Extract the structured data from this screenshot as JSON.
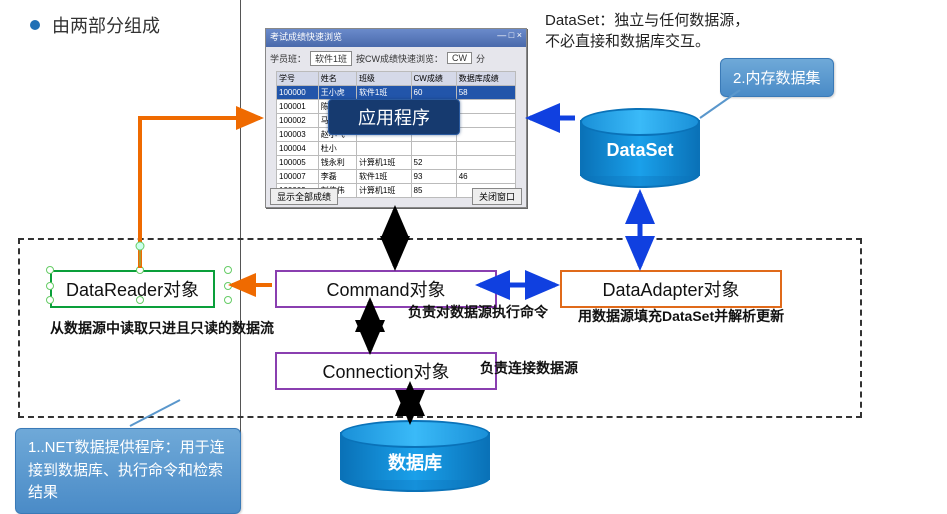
{
  "header": {
    "bullet_title": "由两部分组成"
  },
  "dataset_desc": {
    "line1": "DataSet：独立与任何数据源，",
    "line2": "不必直接和数据库交互。"
  },
  "app_window": {
    "title": "考试成绩快速浏览",
    "toolbar": {
      "label1": "学员班：",
      "combo1": "软件1班",
      "label2": "按CW成绩快速浏览：",
      "combo2": "CW",
      "label3": "分"
    },
    "columns": [
      "学号",
      "姓名",
      "班级",
      "CW成绩",
      "数据库成绩"
    ],
    "rows": [
      [
        "100000",
        "王小虎",
        "软件1班",
        "60",
        "58"
      ],
      [
        "100001",
        "陈小涛",
        "",
        "",
        ""
      ],
      [
        "100002",
        "马小",
        "",
        "",
        ""
      ],
      [
        "100003",
        "赵小飞",
        "",
        "",
        ""
      ],
      [
        "100004",
        "杜小",
        "",
        "",
        ""
      ],
      [
        "100005",
        "钱永利",
        "计算机1班",
        "52",
        ""
      ],
      [
        "100007",
        "李磊",
        "软件1班",
        "93",
        "46"
      ],
      [
        "100009",
        "刘伟伟",
        "计算机1班",
        "85",
        ""
      ]
    ],
    "btn_left": "显示全部成绩",
    "btn_right": "关闭窗口"
  },
  "app_tag": "应用程序",
  "callouts": {
    "mem_dataset": "2.内存数据集",
    "net_provider": "1..NET数据提供程序：用于连接到数据库、执行命令和检索结果"
  },
  "cylinders": {
    "dataset": "DataSet",
    "database": "数据库"
  },
  "objects": {
    "reader": "DataReader对象",
    "command": "Command对象",
    "adapter": "DataAdapter对象",
    "connection": "Connection对象"
  },
  "descriptions": {
    "reader": "从数据源中读取只进且只读的数据流",
    "command": "负责对数据源执行命令",
    "connection": "负责连接数据源",
    "adapter": "用数据源填充DataSet并解析更新"
  }
}
